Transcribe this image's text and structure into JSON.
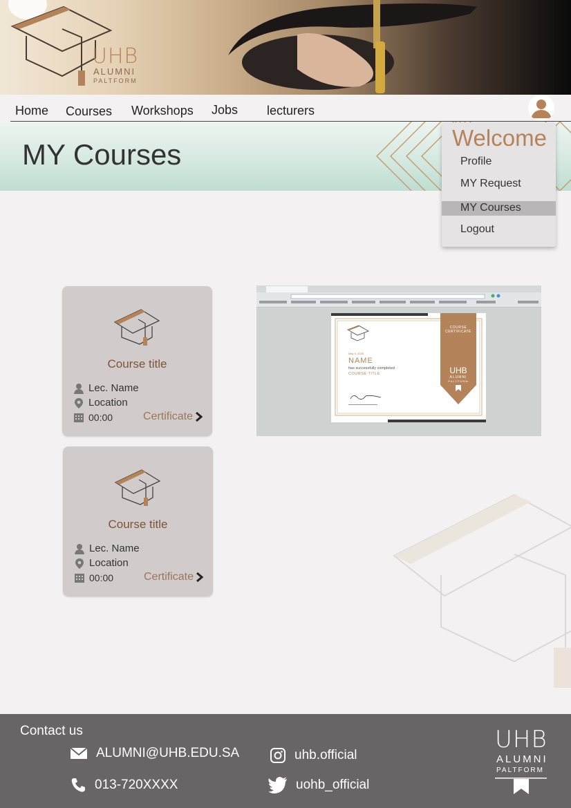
{
  "logo": {
    "name": "UHB",
    "alumni": "ALUMNI",
    "platform": "PALTFORM"
  },
  "nav": {
    "items": [
      {
        "label": "Home"
      },
      {
        "label": "Courses"
      },
      {
        "label": "Workshops"
      },
      {
        "label": "Jobs"
      },
      {
        "label": "lecturers"
      }
    ]
  },
  "page_title": "MY Courses",
  "menu": {
    "welcome": "Welcome",
    "items": [
      {
        "label": "Profile"
      },
      {
        "label": "MY Request"
      },
      {
        "label": "MY Courses",
        "active": true
      },
      {
        "label": "Logout"
      }
    ]
  },
  "courses": [
    {
      "title": "Course title",
      "lecturer": "Lec. Name",
      "location": "Location",
      "time": "00:00",
      "certificate": "Certificate"
    },
    {
      "title": "Course title",
      "lecturer": "Lec. Name",
      "location": "Location",
      "time": "00:00",
      "certificate": "Certificate"
    }
  ],
  "certificate_preview": {
    "badge_line1": "COURSE",
    "badge_line2": "CERTIFICATE",
    "name": "NAME",
    "text": "has successfully completed",
    "course": "COURSE TITLE",
    "date": "May 5, 2025",
    "brand": "UHB",
    "brand_sub": "ALUMNI",
    "brand_sub2": "PALTFORM"
  },
  "footer": {
    "contact_label": "Contact us",
    "email": "ALUMNI@UHB.EDU.SA",
    "phone": "013-720XXXX",
    "instagram": "uhb.official",
    "twitter": "uohb_official"
  },
  "colors": {
    "accent": "#b5835a",
    "footer_bg": "#676566",
    "card_bg": "#d1cccb",
    "page_bg": "#f4f1f3"
  }
}
